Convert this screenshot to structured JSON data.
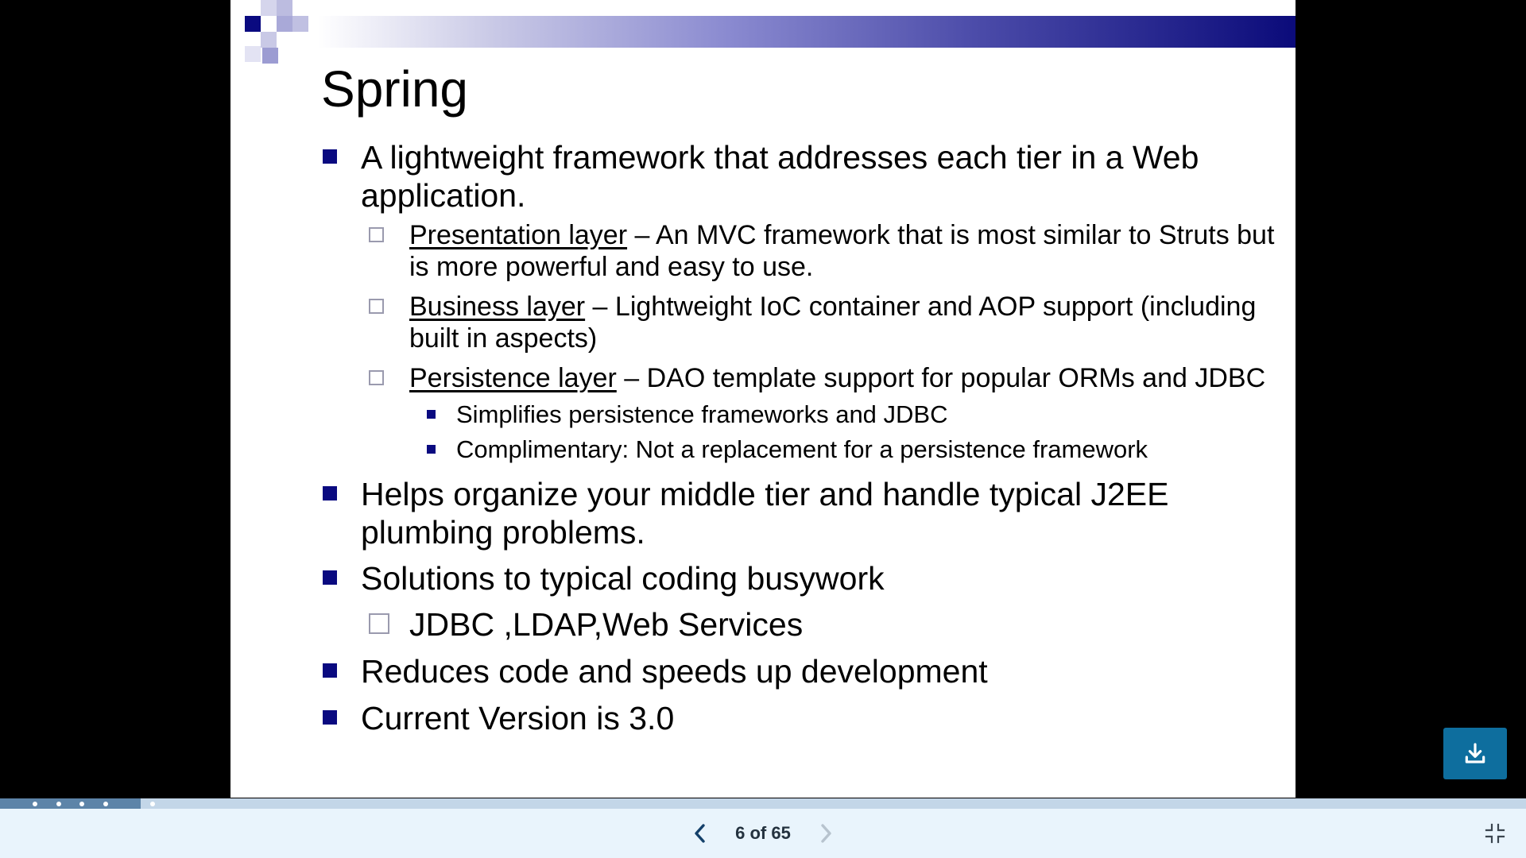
{
  "slide": {
    "title": "Spring",
    "bullets": [
      {
        "text": "A lightweight framework that addresses each tier in a Web application."
      },
      {
        "term": "Presentation layer",
        "text": " – An MVC framework that is most similar to Struts but is more powerful and easy to use."
      },
      {
        "term": "Business layer",
        "text": " – Lightweight IoC container and AOP support (including built in aspects)"
      },
      {
        "term": "Persistence layer",
        "text": " – DAO template support for popular ORMs and JDBC"
      },
      {
        "text": "Simplifies persistence frameworks and JDBC"
      },
      {
        "text": "Complimentary: Not a replacement for a persistence framework"
      },
      {
        "text": "Helps organize your middle tier and handle typical J2EE plumbing problems."
      },
      {
        "text": "Solutions to typical coding busywork"
      },
      {
        "text": "JDBC ,LDAP,Web Services"
      },
      {
        "text": "Reduces code and speeds up development"
      },
      {
        "text": "Current Version is 3.0"
      }
    ]
  },
  "navigation": {
    "current_page": 6,
    "total_pages": 65,
    "page_label": "6 of 65",
    "prev_icon": "chevron-left-icon",
    "next_icon": "chevron-right-icon",
    "next_enabled": false
  },
  "progress": {
    "fraction": 0.092
  },
  "toolbar": {
    "download_icon": "download-icon",
    "exit_fullscreen_icon": "exit-fullscreen-icon"
  },
  "colors": {
    "bullet": "#0a0a80",
    "title_bar_end": "#0b0b7a",
    "download_button": "#0e6e9e",
    "bottom_bar": "#e9f4fc",
    "progress_track": "#c3d6e8",
    "progress_fill": "#5d84a8"
  }
}
